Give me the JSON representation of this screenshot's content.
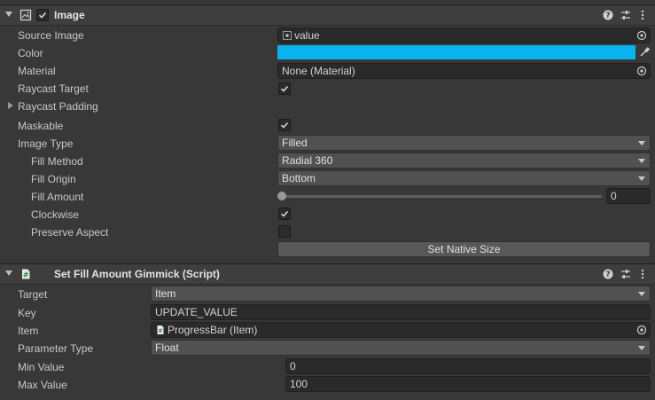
{
  "image_component": {
    "title": "Image",
    "fields": {
      "source_image": {
        "label": "Source Image",
        "value": "value"
      },
      "color": {
        "label": "Color",
        "value_hex": "#0ab2ee"
      },
      "material": {
        "label": "Material",
        "value": "None (Material)"
      },
      "raycast_target": {
        "label": "Raycast Target",
        "checked": true
      },
      "raycast_padding": {
        "label": "Raycast Padding"
      },
      "maskable": {
        "label": "Maskable",
        "checked": true
      },
      "image_type": {
        "label": "Image Type",
        "value": "Filled"
      },
      "fill_method": {
        "label": "Fill Method",
        "value": "Radial 360"
      },
      "fill_origin": {
        "label": "Fill Origin",
        "value": "Bottom"
      },
      "fill_amount": {
        "label": "Fill Amount",
        "value": "0",
        "fraction": 0
      },
      "clockwise": {
        "label": "Clockwise",
        "checked": true
      },
      "preserve_aspect": {
        "label": "Preserve Aspect",
        "checked": false
      }
    },
    "set_native_size_label": "Set Native Size"
  },
  "gimmick_component": {
    "title": "Set Fill Amount Gimmick (Script)",
    "fields": {
      "target": {
        "label": "Target",
        "value": "Item"
      },
      "key": {
        "label": "Key",
        "value": "UPDATE_VALUE"
      },
      "item": {
        "label": "Item",
        "value": "ProgressBar (Item)"
      },
      "parameter_type": {
        "label": "Parameter Type",
        "value": "Float"
      },
      "min_value": {
        "label": "Min Value",
        "value": "0"
      },
      "max_value": {
        "label": "Max Value",
        "value": "100"
      }
    }
  },
  "icons": {
    "header": [
      "image-component-icon",
      "enable-checkbox",
      "help-icon",
      "presets-icon",
      "more-menu-icon"
    ],
    "script_icon": "script-hash-icon",
    "picker": "object-picker-icon",
    "eyedropper": "eyedropper-icon"
  },
  "colors": {
    "color_field": "#0ab2ee",
    "check": "#d8d8d8"
  }
}
